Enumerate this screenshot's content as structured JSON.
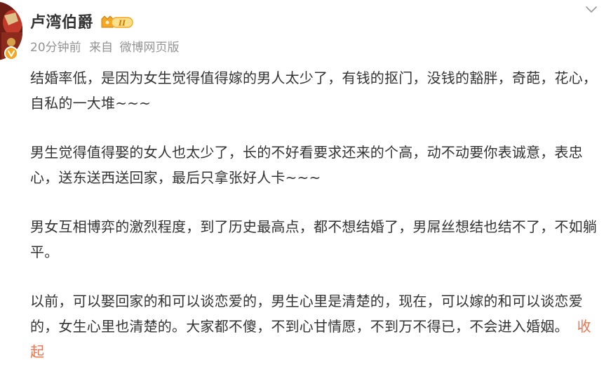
{
  "author": {
    "name": "卢湾伯爵",
    "level_badge": "II",
    "avatar_icon": "avatar-image",
    "verified_icon": "verified-v-icon"
  },
  "meta": {
    "time": "20分钟前",
    "source_prefix": "来自",
    "source": "微博网页版"
  },
  "paragraphs": [
    "结婚率低，是因为女生觉得值得嫁的男人太少了，有钱的抠门，没钱的豁胖，奇葩，花心，自私的一大堆~~~",
    "男生觉得值得娶的女人也太少了，长的不好看要求还来的个高，动不动要你表诚意，表忠心，送东送西送回家，最后只拿张好人卡~~~",
    "男女互相博弈的激烈程度，到了历史最高点，都不想结婚了，男屌丝想结也结不了，不如躺平。",
    "以前，可以娶回家的和可以谈恋爱的，男生心里是清楚的，现在，可以嫁的和可以谈恋爱的，女生心里也清楚的。大家都不傻，不到心甘情愿，不到万不得已，不会进入婚姻。"
  ],
  "collapse_label": "收起",
  "colors": {
    "text": "#333333",
    "meta": "#939393",
    "link_orange": "#eb7350",
    "badge_gold": "#f5a623"
  }
}
